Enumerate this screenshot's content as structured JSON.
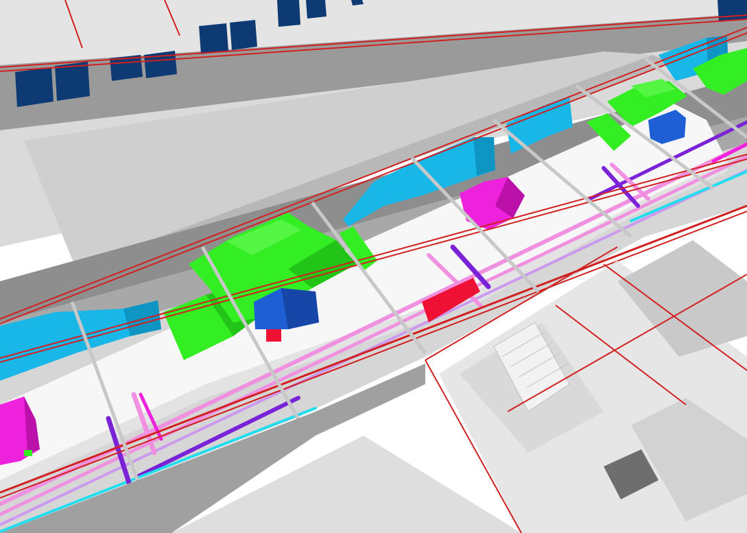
{
  "colors": {
    "background": "#FFFFFF",
    "roof_light": "#DADADA",
    "roof_mid": "#C9C9C9",
    "wall_dark": "#8E8E8E",
    "wall_mid": "#A9A9A9",
    "corridor_floor": "#D6D6D6",
    "white_duct": "#F7F7F7",
    "window_blue": "#0E3A73",
    "duct_cyan": "#19B6E8",
    "duct_cyan_shade": "#0E95C4",
    "duct_green": "#33EE22",
    "duct_green_shade": "#22C417",
    "equipment_blue": "#1F5FD6",
    "equipment_blue_shade": "#1646A8",
    "equipment_magenta": "#EE22DD",
    "equipment_magenta_shade": "#BB11AA",
    "pipe_pink": "#F090E0",
    "pipe_violet": "#7A22D8",
    "pipe_cyan": "#22DDEE",
    "pipe_red": "#EE1133",
    "structure_red": "#D21F1F",
    "stair_white": "#F2F2F2",
    "shaft_dark": "#6E6E6E"
  },
  "visible_systems": [
    "window-glazing",
    "supply-air-duct",
    "return-air-duct",
    "air-handling-unit",
    "fan-coil-unit",
    "pipe-heating",
    "pipe-chilled-water",
    "pipe-domestic-water",
    "pipe-fire",
    "steel-frame",
    "stairwell"
  ]
}
